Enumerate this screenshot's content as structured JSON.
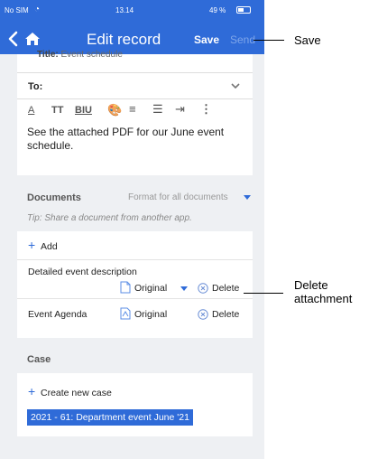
{
  "status_bar": {
    "carrier": "No SIM",
    "time": "13.14",
    "battery": "49 %",
    "battery_level": 0.49
  },
  "nav": {
    "title": "Edit record",
    "save_label": "Save",
    "send_label": "Send"
  },
  "record": {
    "title_label": "Title:",
    "title_value": "Event schedule",
    "to_label": "To:",
    "toolbar": [
      "A",
      "TT",
      "BIU",
      "palette",
      "align",
      "list",
      "indent",
      "more"
    ],
    "body": "See the attached PDF for our June event schedule."
  },
  "documents": {
    "header": "Documents",
    "format_all": "Format for all documents",
    "tip": "Tip: Share a document from another app.",
    "add_label": "Add",
    "items": [
      {
        "name": "Detailed event description",
        "format": "Original",
        "delete_label": "Delete"
      },
      {
        "name": "Event Agenda",
        "format": "Original",
        "delete_label": "Delete"
      }
    ]
  },
  "case": {
    "header": "Case",
    "create_label": "Create new case",
    "selected": "2021 - 61: Department event June '21"
  },
  "callouts": {
    "save": "Save",
    "delete": [
      "Delete",
      "attachment"
    ]
  },
  "icons": {
    "back": "chevron-left-icon",
    "home": "home-icon",
    "chevron": "chevron-down-icon",
    "file": "pdf-file-icon",
    "delete": "delete-circle-icon",
    "plus": "plus-icon",
    "wifi": "wifi-icon",
    "battery": "battery-icon"
  },
  "colors": {
    "accent": "#2f6bd8",
    "background": "#eef0f3"
  }
}
